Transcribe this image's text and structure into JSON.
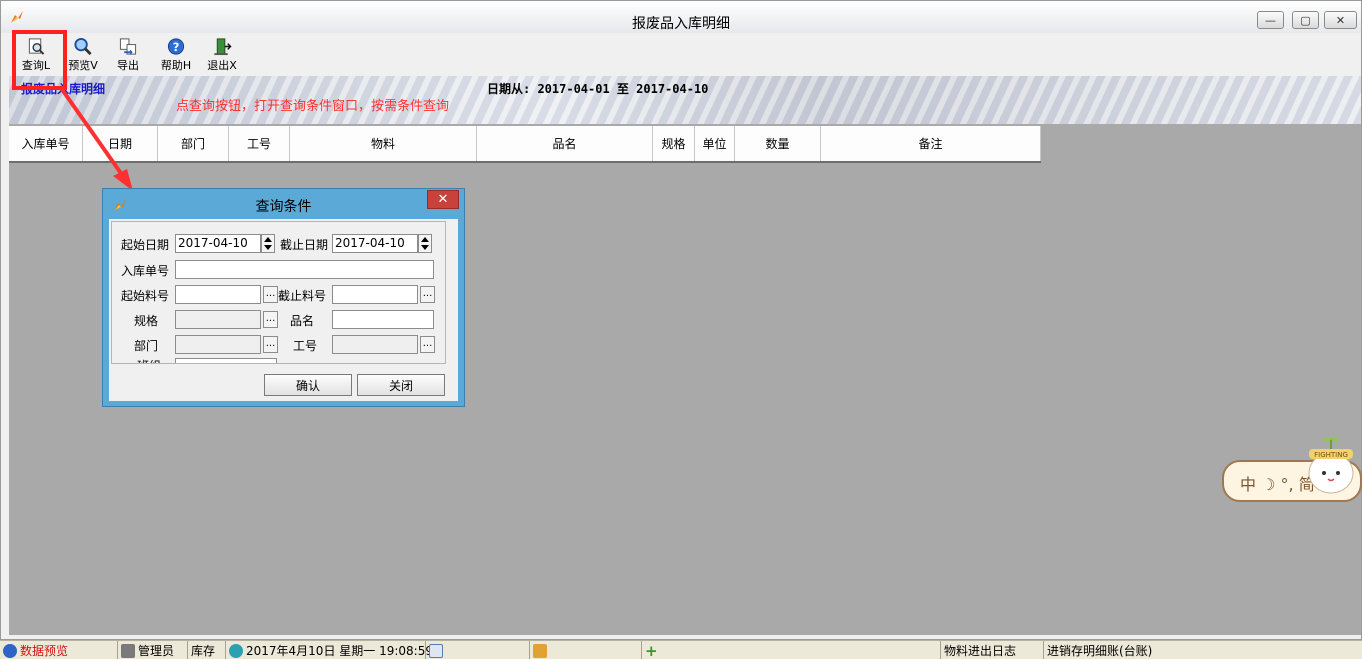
{
  "window": {
    "title": "报废品入库明细",
    "minimize_glyph": "—",
    "maximize_glyph": "▢",
    "close_glyph": "✕"
  },
  "toolbar": {
    "items": [
      {
        "label": "查询L",
        "icon": "query-doc-icon"
      },
      {
        "label": "预览V",
        "icon": "magnifier-icon"
      },
      {
        "label": "导出",
        "icon": "export-icon"
      },
      {
        "label": "帮助H",
        "icon": "help-icon"
      },
      {
        "label": "退出X",
        "icon": "exit-door-icon"
      }
    ]
  },
  "banner": {
    "report_title": "报废品入库明细",
    "date_range": "日期从: 2017-04-01 至 2017-04-10"
  },
  "annotation": "点查询按钮，打开查询条件窗口，按需条件查询",
  "grid": {
    "columns": [
      "入库单号",
      "日期",
      "部门",
      "工号",
      "物料",
      "品名",
      "规格",
      "单位",
      "数量",
      "备注"
    ]
  },
  "dialog": {
    "title": "查询条件",
    "close_glyph": "✕",
    "start_date_label": "起始日期",
    "start_date_value": "2017-04-10",
    "end_date_label": "截止日期",
    "end_date_value": "2017-04-10",
    "doc_no_label": "入库单号",
    "doc_no_value": "",
    "start_item_label": "起始料号",
    "start_item_value": "",
    "end_item_label": "截止料号",
    "end_item_value": "",
    "spec_label": "规格",
    "spec_value": "",
    "name_label": "品名",
    "name_value": "",
    "dept_label": "部门",
    "dept_value": "",
    "emp_label": "工号",
    "emp_value": "",
    "team_label": "班组",
    "team_value": "",
    "ellipsis": "...",
    "confirm_label": "确认",
    "close_label": "关闭"
  },
  "ime_widget": {
    "text": "中 ☽ °, 简",
    "mascot_caption": "FIGHTING"
  },
  "statusbar": {
    "items": [
      {
        "text": "数据预览",
        "color": "#d01010"
      },
      {
        "text": "管理员"
      },
      {
        "text": "库存"
      },
      {
        "text": "2017年4月10日 星期一 19:08:59"
      },
      {
        "text": ""
      },
      {
        "text": ""
      },
      {
        "text": ""
      },
      {
        "text": "物料进出日志"
      },
      {
        "text": "进销存明细账(台账)"
      }
    ]
  },
  "colors": {
    "highlight": "#ff2020",
    "annotation": "#ff3030",
    "dialog_frame": "#5aa9d6",
    "grid_background": "#a9a9a9"
  }
}
